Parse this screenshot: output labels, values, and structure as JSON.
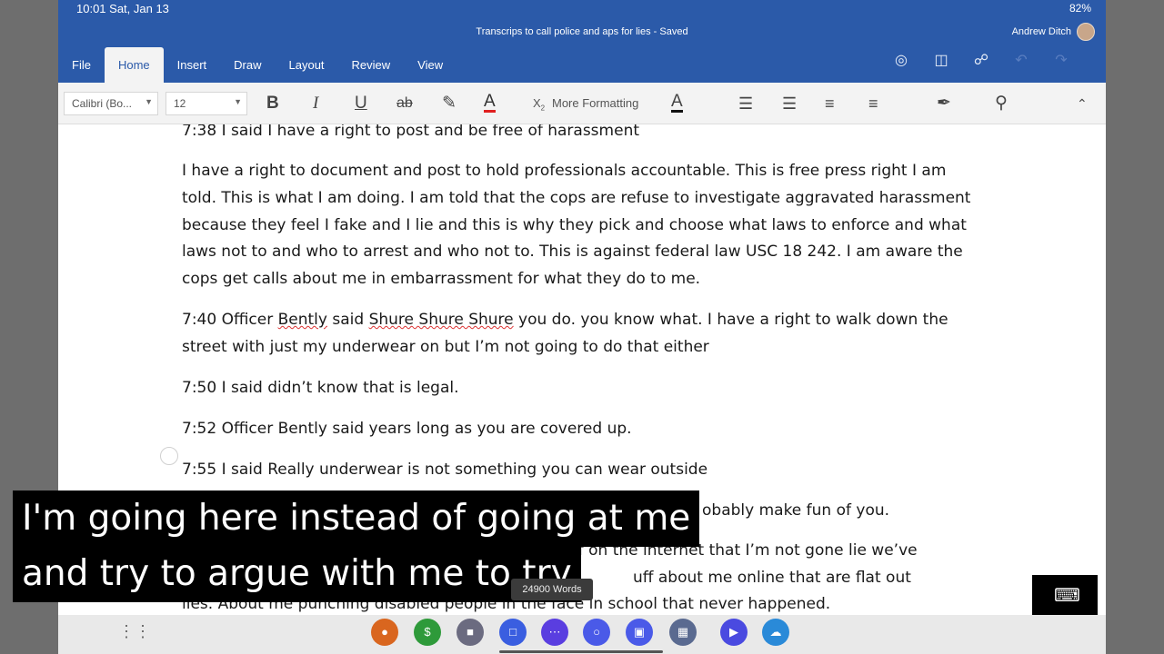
{
  "status_bar": {
    "time": "10:01 Sat, Jan 13",
    "battery": "82%"
  },
  "window": {
    "title": "Transcrips to call police and aps for lies - Saved",
    "user": "Andrew Ditch"
  },
  "tabs": [
    {
      "label": "File"
    },
    {
      "label": "Home"
    },
    {
      "label": "Insert"
    },
    {
      "label": "Draw"
    },
    {
      "label": "Layout"
    },
    {
      "label": "Review"
    },
    {
      "label": "View"
    }
  ],
  "active_tab": "Home",
  "toolbar": {
    "font_name": "Calibri (Bo...",
    "font_size": "12",
    "more_formatting": "More Formatting",
    "subscript_label": "X"
  },
  "document": {
    "paragraphs": [
      "7:38 I said I have a right to post and be free of harassment",
      "I have a right to document and post to hold professionals accountable. This is free press right I am told. This is what I am doing. I am told that the cops are refuse to investigate aggravated harassment because they feel I fake and I lie and this is why they pick and choose what laws to enforce and what laws not to and who to arrest and who not to. This is against federal law USC 18 242. I am aware the cops get calls about me in embarrassment for what they do to me.",
      "7:40 Officer Bently said Shure Shure Shure you do. you know what. I have a right to walk down the street with just my underwear on but I’m not going to do that either",
      "7:50 I said didn’t know that is legal.",
      "7:52 Officer Bently said years long as you are covered up.",
      "7:55 I said Really underwear is not something you can wear outside",
      "obably make fun of you.",
      "ff on the internet that I’m not gone lie we’ve",
      "uff about me online that are flat out",
      "lies. About me punching disabled people in the face in school that never happened."
    ]
  },
  "word_count": "24900 Words",
  "captions": {
    "line1": "I'm going here instead of going at me",
    "line2": "and try to argue with me to try"
  }
}
